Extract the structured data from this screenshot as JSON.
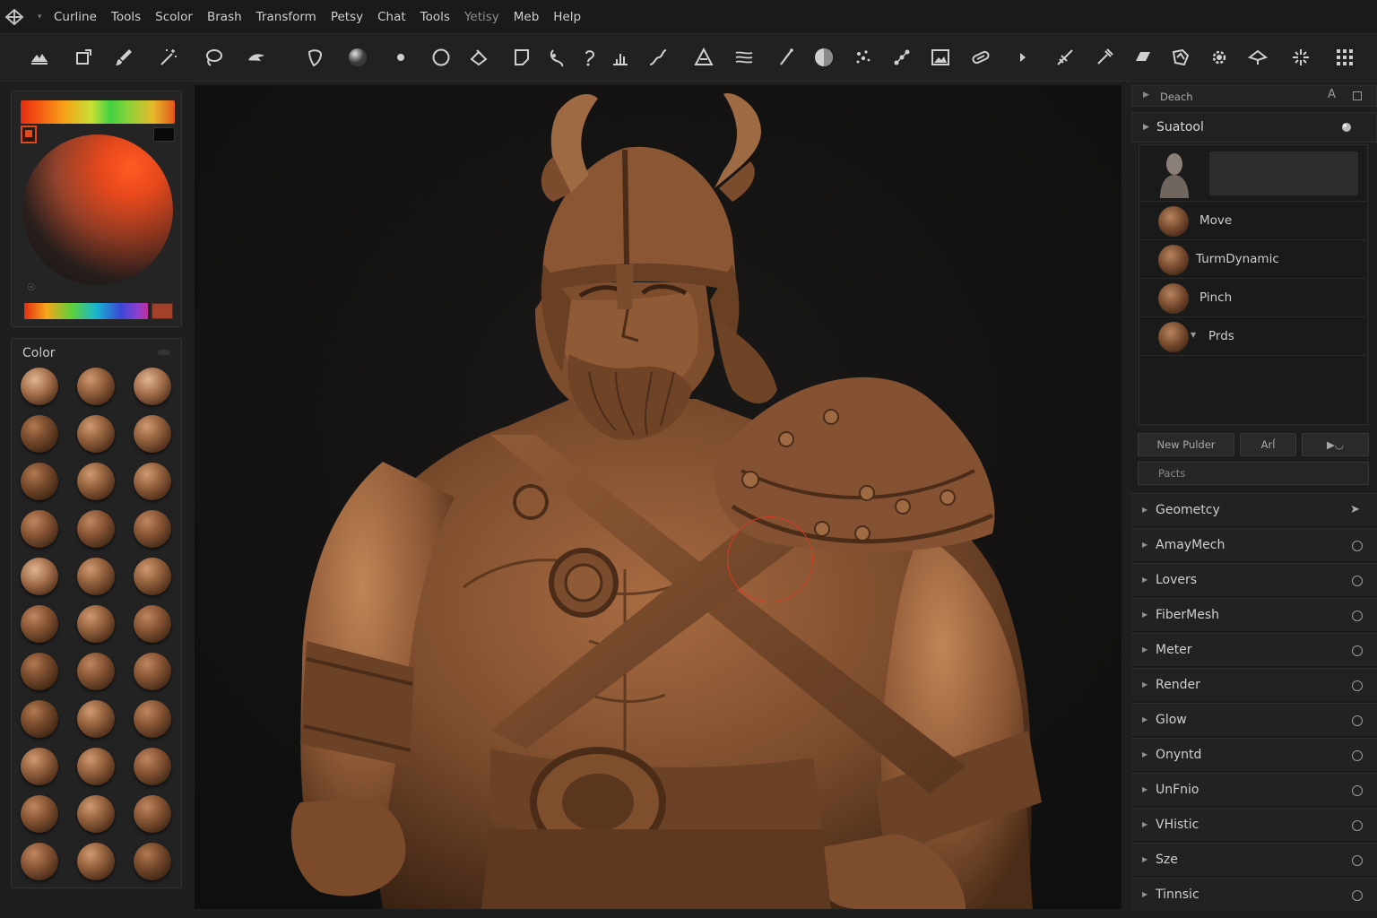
{
  "menu": {
    "items": [
      "Curline",
      "Tools",
      "Scolor",
      "Brash",
      "Transform",
      "Petsy",
      "Chat",
      "Tools",
      "Yetisy",
      "Meb",
      "Help"
    ]
  },
  "toolbar": {
    "tools": [
      "navigate-icon",
      "frame-icon",
      "brush-icon",
      "magic-icon",
      "lasso-icon",
      "smudge-icon",
      "mask-icon",
      "sphere-material-icon",
      "dot-icon",
      "circle-icon",
      "clay-icon",
      "square-icon",
      "pinch-icon",
      "inflate-icon",
      "standard-icon",
      "curve-icon",
      "trim-icon",
      "stripe-icon",
      "line-icon",
      "halfmoon-icon",
      "scatter-icon",
      "dots-icon",
      "image-icon",
      "link-icon",
      "arrow-icon",
      "cut-icon",
      "pen-icon",
      "flatten-icon",
      "polish-icon",
      "gear-icon",
      "plane-icon",
      "sparkle-icon",
      "grid-icon"
    ]
  },
  "material": {
    "title": "Color"
  },
  "right_panel": {
    "header_label": "Deach",
    "header_a": "A",
    "tool_section": "Suatool",
    "brushes": [
      {
        "name": "Move"
      },
      {
        "name": "TurmDynamic"
      },
      {
        "name": "Pinch"
      },
      {
        "name": "Prds"
      }
    ],
    "buttons": {
      "new": "New Pulder",
      "mid": "Arĺ",
      "right": "▶◡"
    },
    "search_placeholder": "Pacts",
    "subpalettes": [
      "Geometcy",
      "AmayMech",
      "Lovers",
      "FiberMesh",
      "Meter",
      "Render",
      "Glow",
      "Onyntd",
      "UnFnio",
      "VHistic",
      "Sze",
      "Tinnsic"
    ]
  },
  "colors": {
    "accent": "#e0461c",
    "clay": "#8a5634",
    "cursor": "#d93a22"
  }
}
